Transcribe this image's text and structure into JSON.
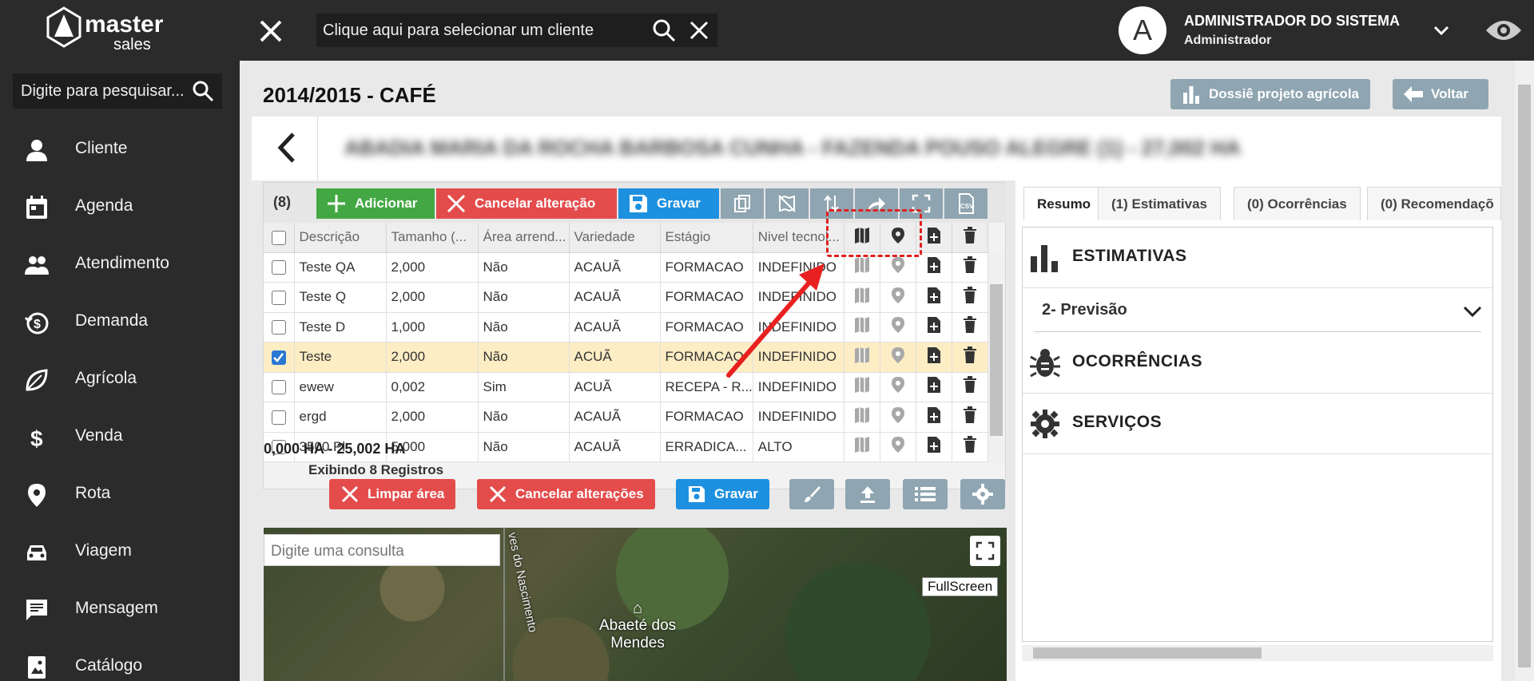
{
  "header": {
    "logo_text": "master",
    "logo_sub": "sales",
    "client_placeholder": "Clique aqui para selecionar um cliente",
    "avatar_letter": "A",
    "user_name": "ADMINISTRADOR DO SISTEMA",
    "user_role": "Administrador"
  },
  "sidebar": {
    "search_placeholder": "Digite para pesquisar...",
    "items": [
      {
        "label": "Cliente",
        "icon": "person-icon"
      },
      {
        "label": "Agenda",
        "icon": "calendar-icon"
      },
      {
        "label": "Atendimento",
        "icon": "people-icon"
      },
      {
        "label": "Demanda",
        "icon": "demand-icon"
      },
      {
        "label": "Agrícola",
        "icon": "leaf-icon"
      },
      {
        "label": "Venda",
        "icon": "dollar-icon"
      },
      {
        "label": "Rota",
        "icon": "pin-icon"
      },
      {
        "label": "Viagem",
        "icon": "car-icon"
      },
      {
        "label": "Mensagem",
        "icon": "message-icon"
      },
      {
        "label": "Catálogo",
        "icon": "catalog-icon"
      }
    ]
  },
  "page": {
    "title": "2014/2015 - CAFÉ",
    "dossie_label": "Dossiê projeto agrícola",
    "back_label": "Voltar",
    "client_name": "ABADIA MARIA DA ROCHA BARBOSA CUNHA - FAZENDA POUSO ALEGRE (1) - 27,002 HA"
  },
  "grid": {
    "count": "(8)",
    "add_label": "Adicionar",
    "cancel_label": "Cancelar alteração",
    "save_label": "Gravar",
    "columns": [
      "Descrição",
      "Tamanho (...",
      "Área arrend...",
      "Variedade",
      "Estágio",
      "Nivel tecnol..."
    ],
    "rows": [
      {
        "desc": "Teste QA",
        "size": "2,000",
        "area": "Não",
        "variety": "ACAUÃ",
        "stage": "FORMACAO",
        "level": "INDEFINIDO",
        "checked": false
      },
      {
        "desc": "Teste Q",
        "size": "2,000",
        "area": "Não",
        "variety": "ACAUÃ",
        "stage": "FORMACAO",
        "level": "INDEFINIDO",
        "checked": false
      },
      {
        "desc": "Teste D",
        "size": "1,000",
        "area": "Não",
        "variety": "ACAUÃ",
        "stage": "FORMACAO",
        "level": "INDEFINIDO",
        "checked": false
      },
      {
        "desc": "Teste",
        "size": "2,000",
        "area": "Não",
        "variety": "ACUÃ",
        "stage": "FORMACAO",
        "level": "INDEFINIDO",
        "checked": true
      },
      {
        "desc": "ewew",
        "size": "0,002",
        "area": "Sim",
        "variety": "ACUÃ",
        "stage": "RECEPA - R...",
        "level": "INDEFINIDO",
        "checked": false
      },
      {
        "desc": "ergd",
        "size": "2,000",
        "area": "Não",
        "variety": "ACAUÃ",
        "stage": "FORMACAO",
        "level": "INDEFINIDO",
        "checked": false
      },
      {
        "desc": "3500 Pl",
        "size": "5,000",
        "area": "Não",
        "variety": "ACAUÃ",
        "stage": "ERRADICA...",
        "level": "ALTO",
        "checked": false
      }
    ],
    "ha_summary": "0,000 HA - 25,002 HA",
    "pager_text": "Exibindo 8 Registros"
  },
  "map_toolbar": {
    "clear_label": "Limpar área",
    "cancel_label": "Cancelar alterações",
    "save_label": "Gravar"
  },
  "map": {
    "search_placeholder": "Digite uma consulta",
    "fullscreen_tip": "FullScreen",
    "place_line1": "Abaeté dos",
    "place_line2": "Mendes",
    "road_label": "ves do Nascimento"
  },
  "right": {
    "tabs": [
      "Resumo",
      "(1) Estimativas",
      "(0) Ocorrências",
      "(0) Recomendaçõ"
    ],
    "estimativas": "ESTIMATIVAS",
    "previsao": "2- Previsão",
    "ocorrencias": "OCORRÊNCIAS",
    "servicos": "SERVIÇOS"
  },
  "colors": {
    "green": "#43a843",
    "red": "#e44c4c",
    "blue": "#1e90e0",
    "gray": "#8fa5b1",
    "dark": "#2b2b2b"
  }
}
